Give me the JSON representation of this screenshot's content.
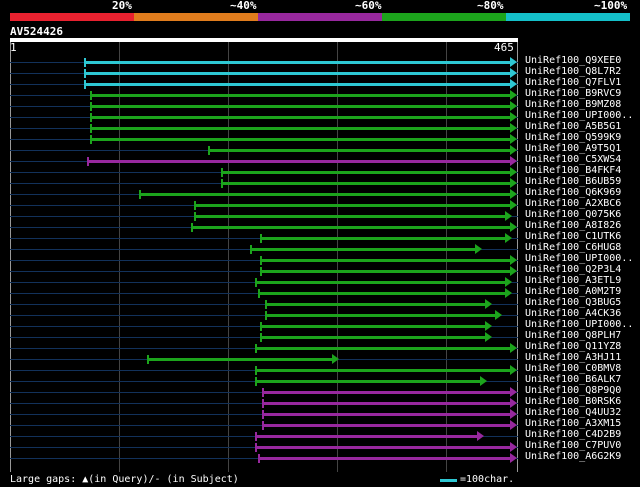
{
  "legend": {
    "percent_labels": [
      "20%",
      "~40%",
      "~60%",
      "~80%",
      "~100%"
    ],
    "colors": [
      "#e8212f",
      "#e07c1d",
      "#98289e",
      "#1ca41c",
      "#14bfc9"
    ]
  },
  "query": {
    "name": "AV524426",
    "start": "1",
    "end": "465"
  },
  "hits": [
    {
      "label": "UniRef100_Q9XEE0",
      "start": 84,
      "end": 510,
      "color": "#2ec7d3",
      "arrow": true
    },
    {
      "label": "UniRef100_Q8L7R2",
      "start": 84,
      "end": 510,
      "color": "#2ec7d3",
      "arrow": true
    },
    {
      "label": "UniRef100_Q7FLV1",
      "start": 84,
      "end": 510,
      "color": "#2ec7d3",
      "arrow": true
    },
    {
      "label": "UniRef100_B9RVC9",
      "start": 90,
      "end": 510,
      "color": "#1ca41c",
      "arrow": true
    },
    {
      "label": "UniRef100_B9MZ08",
      "start": 90,
      "end": 510,
      "color": "#1ca41c",
      "arrow": true
    },
    {
      "label": "UniRef100_UPI000..",
      "start": 90,
      "end": 510,
      "color": "#1ca41c",
      "arrow": true
    },
    {
      "label": "UniRef100_A5B5G1",
      "start": 90,
      "end": 510,
      "color": "#1ca41c",
      "arrow": true
    },
    {
      "label": "UniRef100_Q599K9",
      "start": 90,
      "end": 510,
      "color": "#1ca41c",
      "arrow": true
    },
    {
      "label": "UniRef100_A9T5Q1",
      "start": 208,
      "end": 510,
      "color": "#1ca41c",
      "arrow": true
    },
    {
      "label": "UniRef100_C5XWS4",
      "start": 87,
      "end": 510,
      "color": "#98289e",
      "arrow": true
    },
    {
      "label": "UniRef100_B4FKF4",
      "start": 221,
      "end": 510,
      "color": "#1ca41c",
      "arrow": true
    },
    {
      "label": "UniRef100_B6UB59",
      "start": 221,
      "end": 510,
      "color": "#1ca41c",
      "arrow": true
    },
    {
      "label": "UniRef100_Q6K969",
      "start": 139,
      "end": 510,
      "color": "#1ca41c",
      "arrow": true
    },
    {
      "label": "UniRef100_A2XBC6",
      "start": 194,
      "end": 510,
      "color": "#1ca41c",
      "arrow": true
    },
    {
      "label": "UniRef100_Q075K6",
      "start": 194,
      "end": 505,
      "color": "#1ca41c",
      "arrow": true
    },
    {
      "label": "UniRef100_A8I826",
      "start": 191,
      "end": 510,
      "color": "#1ca41c",
      "arrow": true
    },
    {
      "label": "UniRef100_C1UTK6",
      "start": 260,
      "end": 505,
      "color": "#1ca41c",
      "arrow": true
    },
    {
      "label": "UniRef100_C6HUG8",
      "start": 250,
      "end": 475,
      "color": "#1ca41c",
      "arrow": true
    },
    {
      "label": "UniRef100_UPI000..",
      "start": 260,
      "end": 510,
      "color": "#1ca41c",
      "arrow": true
    },
    {
      "label": "UniRef100_Q2P3L4",
      "start": 260,
      "end": 510,
      "color": "#1ca41c",
      "arrow": true
    },
    {
      "label": "UniRef100_A3ETL9",
      "start": 255,
      "end": 505,
      "color": "#1ca41c",
      "arrow": true
    },
    {
      "label": "UniRef100_A0M2T9",
      "start": 258,
      "end": 505,
      "color": "#1ca41c",
      "arrow": true
    },
    {
      "label": "UniRef100_Q3BUG5",
      "start": 265,
      "end": 485,
      "color": "#1ca41c",
      "arrow": true
    },
    {
      "label": "UniRef100_A4CK36",
      "start": 265,
      "end": 495,
      "color": "#1ca41c",
      "arrow": true
    },
    {
      "label": "UniRef100_UPI000..",
      "start": 260,
      "end": 485,
      "color": "#1ca41c",
      "arrow": true
    },
    {
      "label": "UniRef100_Q8PLH7",
      "start": 260,
      "end": 485,
      "color": "#1ca41c",
      "arrow": true
    },
    {
      "label": "UniRef100_Q11YZ8",
      "start": 255,
      "end": 510,
      "color": "#1ca41c",
      "arrow": true
    },
    {
      "label": "UniRef100_A3HJ11",
      "start": 147,
      "end": 332,
      "color": "#1ca41c",
      "arrow": true
    },
    {
      "label": "UniRef100_C0BMV8",
      "start": 255,
      "end": 510,
      "color": "#1ca41c",
      "arrow": true
    },
    {
      "label": "UniRef100_B6ALK7",
      "start": 255,
      "end": 480,
      "color": "#1ca41c",
      "arrow": true
    },
    {
      "label": "UniRef100_Q8P9Q0",
      "start": 262,
      "end": 510,
      "color": "#98289e",
      "arrow": true
    },
    {
      "label": "UniRef100_B0RSK6",
      "start": 262,
      "end": 510,
      "color": "#98289e",
      "arrow": true
    },
    {
      "label": "UniRef100_Q4UU32",
      "start": 262,
      "end": 510,
      "color": "#98289e",
      "arrow": true
    },
    {
      "label": "UniRef100_A3XM15",
      "start": 262,
      "end": 510,
      "color": "#98289e",
      "arrow": true
    },
    {
      "label": "UniRef100_C4D2B9",
      "start": 255,
      "end": 477,
      "color": "#98289e",
      "arrow": true
    },
    {
      "label": "UniRef100_C7PUV0",
      "start": 255,
      "end": 510,
      "color": "#98289e",
      "arrow": true
    },
    {
      "label": "UniRef100_A6G2K9",
      "start": 258,
      "end": 510,
      "color": "#98289e",
      "arrow": true
    }
  ],
  "footer": {
    "gaps_text": "Large gaps: ▲(in Query)/- (in Subject)",
    "scale_color": "#2ec7d3",
    "scale_text": "=100char."
  }
}
